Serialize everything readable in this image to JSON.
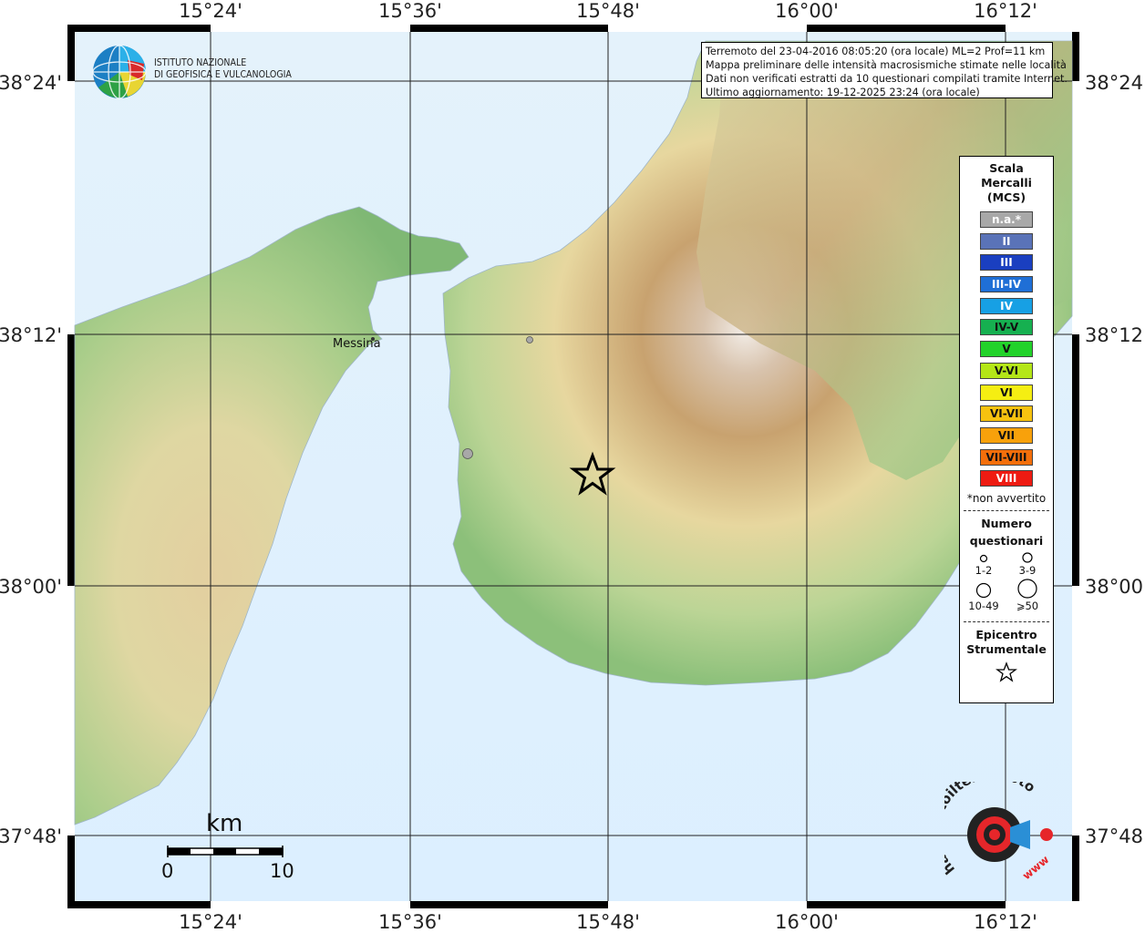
{
  "axes": {
    "top_lon_labels": [
      "15°24'",
      "15°36'",
      "15°48'",
      "16°00'",
      "16°12'"
    ],
    "bottom_lon_labels": [
      "15°24'",
      "15°36'",
      "15°48'",
      "16°00'",
      "16°12'"
    ],
    "left_lat_labels": [
      "38°24'",
      "38°12'",
      "38°00'",
      "37°48'"
    ],
    "right_lat_labels": [
      "38°24'",
      "38°12'",
      "38°00'",
      "37°48'"
    ]
  },
  "logo": {
    "org_line1": "ISTITUTO NAZIONALE",
    "org_line2": "DI GEOFISICA E VULCANOLOGIA"
  },
  "info": {
    "line1": "Terremoto del 23-04-2016 08:05:20 (ora locale) ML=2 Prof=11 km",
    "line2": "Mappa preliminare delle intensità macrosismiche stimate nelle località",
    "line3": "Dati non verificati estratti da 10 questionari compilati tramite Internet.",
    "line4": "Ultimo aggiornamento: 19-12-2025 23:24 (ora locale)"
  },
  "places": {
    "messina": "Messina"
  },
  "intensity_points": [
    {
      "intensity": "n.a.*",
      "questionnaires": "1-2"
    },
    {
      "intensity": "n.a.*",
      "questionnaires": "3-9"
    }
  ],
  "legend": {
    "title1": "Scala",
    "title2": "Mercalli",
    "title3": "(MCS)",
    "scale": [
      {
        "label": "n.a.*",
        "color": "#a8a8a8"
      },
      {
        "label": "II",
        "color": "#5a73b8"
      },
      {
        "label": "III",
        "color": "#1a3fc0"
      },
      {
        "label": "III-IV",
        "color": "#1f6fd6"
      },
      {
        "label": "IV",
        "color": "#17a0e4"
      },
      {
        "label": "IV-V",
        "color": "#16b050"
      },
      {
        "label": "V",
        "color": "#22d22a"
      },
      {
        "label": "V-VI",
        "color": "#b4e617"
      },
      {
        "label": "VI",
        "color": "#f5ee12"
      },
      {
        "label": "VI-VII",
        "color": "#f6c20f"
      },
      {
        "label": "VII",
        "color": "#f8a10b"
      },
      {
        "label": "VII-VIII",
        "color": "#f46f0b"
      },
      {
        "label": "VIII",
        "color": "#ee1b12"
      }
    ],
    "not_felt_note": "*non avvertito",
    "count_title1": "Numero",
    "count_title2": "questionari",
    "counts": [
      "1-2",
      "3-9",
      "10-49",
      "⩾50"
    ],
    "epicenter_title1": "Epicentro",
    "epicenter_title2": "Strumentale"
  },
  "scalebar": {
    "unit": "km",
    "start": "0",
    "end": "10"
  },
  "site_logo": {
    "text": "haisentitoilterremoto.it",
    "url_text": "www"
  }
}
